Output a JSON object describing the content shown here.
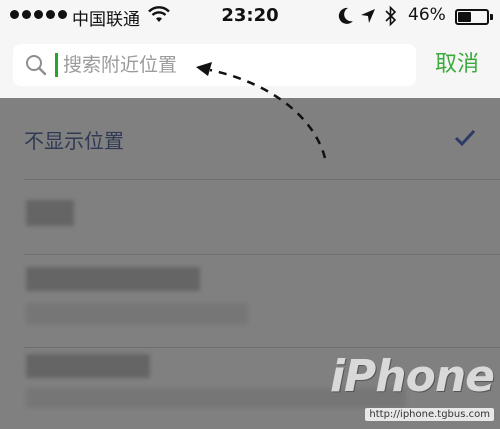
{
  "status_bar": {
    "carrier": "中国联通",
    "time": "23:20",
    "battery_percent": "46%",
    "battery_level": 0.46
  },
  "search": {
    "placeholder": "搜索附近位置",
    "cancel_label": "取消"
  },
  "list": {
    "hide_location_label": "不显示位置"
  },
  "watermark": {
    "logo": "iPhone",
    "url": "http://iphone.tgbus.com"
  },
  "colors": {
    "accent_green": "#3daa3d",
    "check_color": "#2d3a66"
  }
}
